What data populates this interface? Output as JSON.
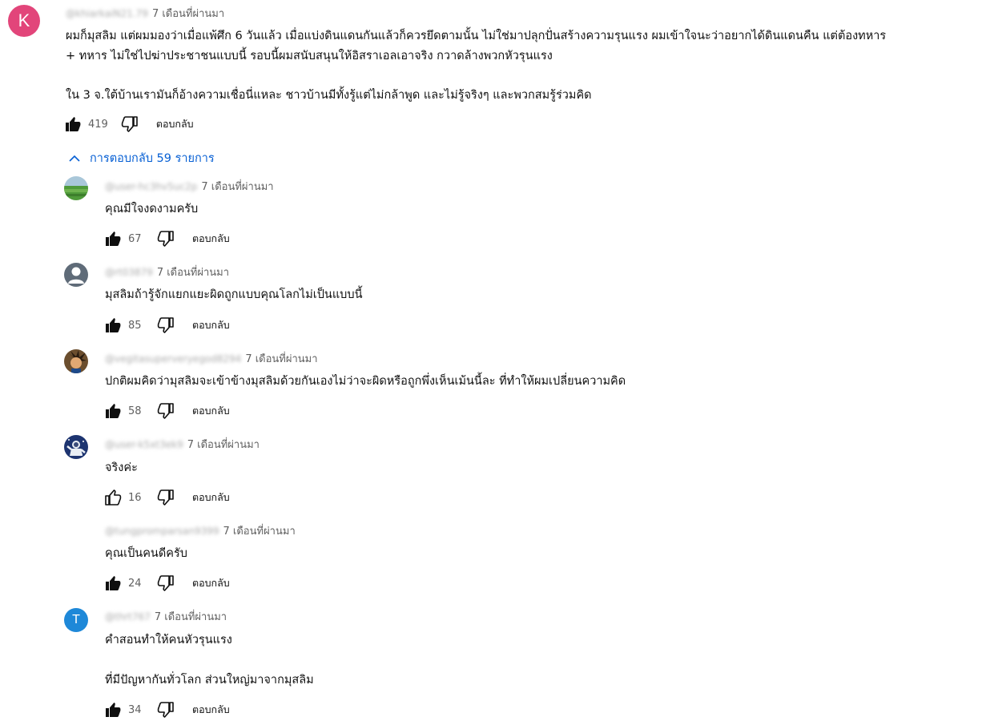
{
  "top_comment": {
    "avatar_letter": "K",
    "avatar_color": "#e2457a",
    "handle": "@khiarkaiN21.79",
    "time": "7 เดือนที่ผ่านมา",
    "lines": [
      "ผมก็มุสลิม แต่ผมมองว่าเมื่อแพ้ศึก 6 วันแล้ว เมื่อแบ่งดินแดนกันแล้วก็ควรยึดตามนั้น ไม่ใช่มาปลุกปั่นสร้างความรุนแรง  ผมเข้าใจนะว่าอยากได้ดินแดนคืน แต่ต้องทหาร",
      "+ ทหาร ไม่ใช่ไปฆ่าประชาชนแบบนี้  รอบนี้ผมสนับสนุนให้อิสราเอลเอาจริง กวาดล้างพวกหัวรุนแรง",
      "ใน 3 จ.ใต้บ้านเรามันก็อ้างความเชื่อนี่แหละ  ชาวบ้านมีทั้งรู้แต่ไม่กล้าพูด และไม่รู้จริงๆ และพวกสมรู้ร่วมคิด"
    ],
    "likes": "419",
    "reply_label": "ตอบกลับ"
  },
  "replies_toggle": {
    "label": "การตอบกลับ 59 รายการ"
  },
  "replies": [
    {
      "avatar": "field-photo",
      "handle": "@user-hc3hv5uc2p",
      "time": "7 เดือนที่ผ่านมา",
      "lines": [
        "คุณมีใจงดงามครับ"
      ],
      "likes": "67",
      "liked": true,
      "reply_label": "ตอบกลับ"
    },
    {
      "avatar": "default-person",
      "handle": "@rt03879",
      "time": "7 เดือนที่ผ่านมา",
      "lines": [
        "มุสลิมถ้ารู้จักแยกแยะผิดถูกแบบคุณโลกไม่เป็นแบบนี้"
      ],
      "likes": "85",
      "liked": true,
      "reply_label": "ตอบกลับ"
    },
    {
      "avatar": "character-photo",
      "handle": "@vegitasuperveryegod8294",
      "time": "7 เดือนที่ผ่านมา",
      "lines": [
        "ปกติผมคิดว่ามุสลิมจะเข้าข้างมุสลิมด้วยกันเองไม่ว่าจะผิดหรือถูกพึ่งเห็นเม้นนี้ละ ที่ทำให้ผมเปลี่ยนความคิด"
      ],
      "likes": "58",
      "liked": true,
      "reply_label": "ตอบกลับ"
    },
    {
      "avatar": "astronaut-photo",
      "handle": "@user-k5xt3ek9",
      "time": "7 เดือนที่ผ่านมา",
      "lines": [
        "จริงค่ะ"
      ],
      "likes": "16",
      "liked": false,
      "reply_label": "ตอบกลับ"
    },
    {
      "avatar": "none",
      "handle": "@tungpromparsan9399",
      "time": "7 เดือนที่ผ่านมา",
      "lines": [
        "คุณเป็นคนดีครับ"
      ],
      "likes": "24",
      "liked": true,
      "reply_label": "ตอบกลับ"
    },
    {
      "avatar": "letter",
      "avatar_letter": "T",
      "avatar_color": "#1e88d8",
      "handle": "@thrt767",
      "time": "7 เดือนที่ผ่านมา",
      "lines": [
        "คำสอนทำให้คนหัวรุนแรง",
        "ที่มีปัญหากันทั่วโลก ส่วนใหญ่มาจากมุสลิม"
      ],
      "likes": "34",
      "liked": true,
      "reply_label": "ตอบกลับ"
    }
  ]
}
